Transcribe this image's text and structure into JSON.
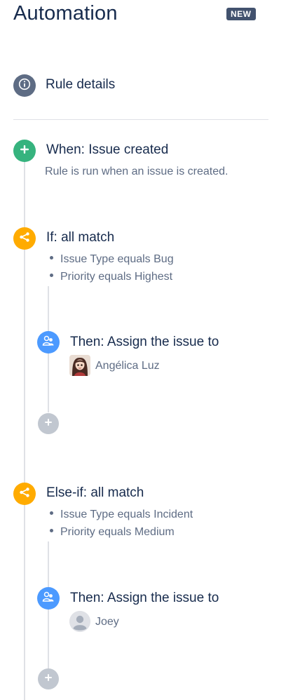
{
  "header": {
    "title": "Automation",
    "badge": "NEW"
  },
  "rule_details": {
    "label": "Rule details",
    "icon": "info-icon"
  },
  "trigger": {
    "title": "When: Issue created",
    "description": "Rule is run when an issue is created.",
    "icon": "plus-icon",
    "color": "#36b37e"
  },
  "branches": [
    {
      "title": "If: all match",
      "icon": "branch-icon",
      "color": "#ffab00",
      "conditions": [
        "Issue Type equals Bug",
        "Priority equals Highest"
      ],
      "action": {
        "title": "Then: Assign the issue to",
        "assignee": "Angélica Luz",
        "icon": "assign-user-icon",
        "color": "#4c9aff"
      },
      "add_icon": "add-icon"
    },
    {
      "title": "Else-if: all match",
      "icon": "branch-icon",
      "color": "#ffab00",
      "conditions": [
        "Issue Type equals Incident",
        "Priority equals Medium"
      ],
      "action": {
        "title": "Then: Assign the issue to",
        "assignee": "Joey",
        "icon": "assign-user-icon",
        "color": "#4c9aff"
      },
      "add_icon": "add-icon"
    }
  ],
  "colors": {
    "line": "#dfe1e6",
    "rule_details_icon": "#5e6c84",
    "add_disabled": "#c1c7d0"
  }
}
